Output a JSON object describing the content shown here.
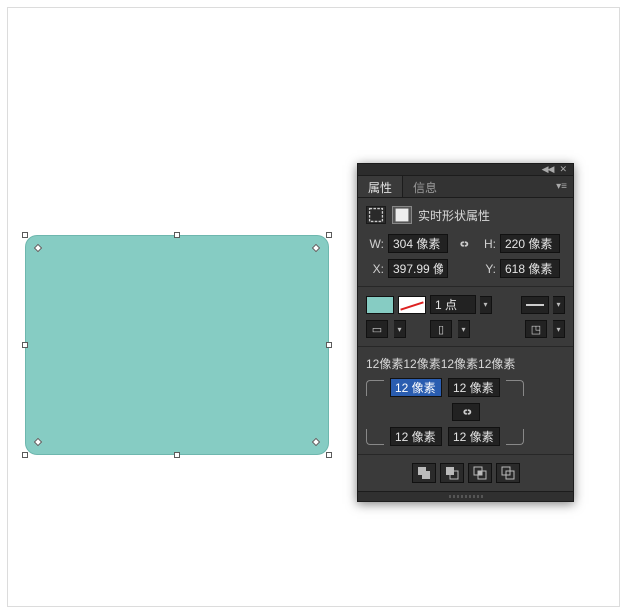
{
  "tabs": {
    "properties": "属性",
    "info": "信息"
  },
  "section_title": "实时形状属性",
  "dimensions": {
    "w_label": "W:",
    "w_value": "304 像素",
    "h_label": "H:",
    "h_value": "220 像素",
    "x_label": "X:",
    "x_value": "397.99 像",
    "y_label": "Y:",
    "y_value": "618 像素"
  },
  "stroke": {
    "weight": "1 点"
  },
  "corners": {
    "summary": "12像素12像素12像素12像素",
    "tl": "12 像素",
    "tr": "12 像素",
    "bl": "12 像素",
    "br": "12 像素"
  },
  "colors": {
    "shape_fill": "#86ccc3"
  }
}
